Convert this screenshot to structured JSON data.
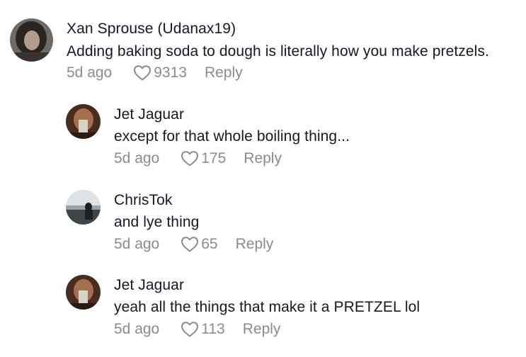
{
  "comments": [
    {
      "author": "Xan Sprouse (Udanax19)",
      "text": "Adding baking soda to dough is literally how you make pretzels.",
      "time": "5d ago",
      "likes": "9313",
      "reply_label": "Reply"
    },
    {
      "author": "Jet Jaguar",
      "text": "except for that whole boiling thing...",
      "time": "5d ago",
      "likes": "175",
      "reply_label": "Reply"
    },
    {
      "author": "ChrisTok",
      "text": "and lye thing",
      "time": "5d ago",
      "likes": "65",
      "reply_label": "Reply"
    },
    {
      "author": "Jet Jaguar",
      "text": "yeah all the things that make it a PRETZEL lol",
      "time": "5d ago",
      "likes": "113",
      "reply_label": "Reply"
    }
  ],
  "icons": {
    "like": "heart-outline-icon"
  },
  "colors": {
    "text": "#161823",
    "muted": "#8a8b91"
  }
}
